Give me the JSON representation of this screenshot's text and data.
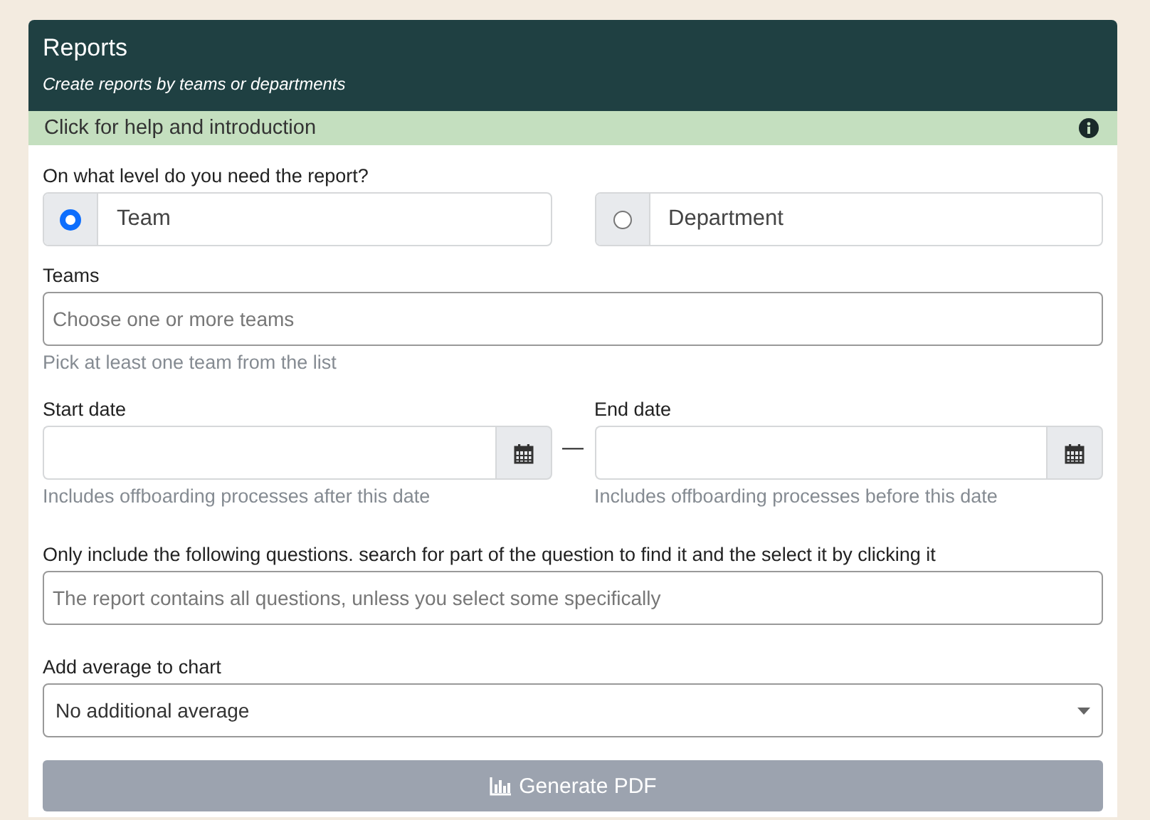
{
  "header": {
    "title": "Reports",
    "subtitle": "Create reports by teams or departments"
  },
  "help_bar": {
    "label": "Click for help and introduction"
  },
  "level": {
    "label": "On what level do you need the report?",
    "options": [
      {
        "label": "Team",
        "selected": true
      },
      {
        "label": "Department",
        "selected": false
      }
    ]
  },
  "teams": {
    "label": "Teams",
    "placeholder": "Choose one or more teams",
    "hint": "Pick at least one team from the list"
  },
  "dates": {
    "separator": "—",
    "fields": [
      {
        "label": "Start date",
        "hint": "Includes offboarding processes after this date"
      },
      {
        "label": "End date",
        "hint": "Includes offboarding processes before this date"
      }
    ]
  },
  "questions": {
    "label": "Only include the following questions. search for part of the question to find it and the select it by clicking it",
    "placeholder": "The report contains all questions, unless you select some specifically"
  },
  "average": {
    "label": "Add average to chart",
    "value": "No additional average"
  },
  "generate_button": {
    "label": "Generate PDF",
    "disabled": true
  }
}
